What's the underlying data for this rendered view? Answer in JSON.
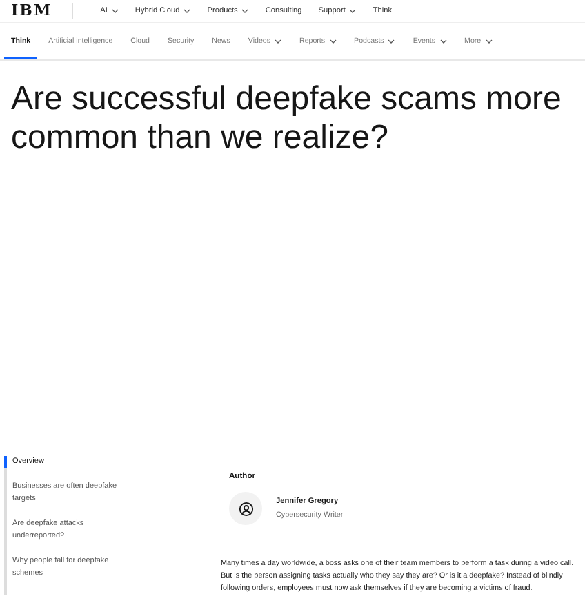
{
  "header": {
    "logo": "IBM",
    "items": [
      {
        "label": "AI",
        "dropdown": true
      },
      {
        "label": "Hybrid Cloud",
        "dropdown": true
      },
      {
        "label": "Products",
        "dropdown": true
      },
      {
        "label": "Consulting",
        "dropdown": false
      },
      {
        "label": "Support",
        "dropdown": true
      },
      {
        "label": "Think",
        "dropdown": false
      }
    ]
  },
  "subnav": [
    {
      "label": "Think",
      "selected": true,
      "dropdown": false
    },
    {
      "label": "Artificial intelligence",
      "selected": false,
      "dropdown": false
    },
    {
      "label": "Cloud",
      "selected": false,
      "dropdown": false
    },
    {
      "label": "Security",
      "selected": false,
      "dropdown": false
    },
    {
      "label": "News",
      "selected": false,
      "dropdown": false
    },
    {
      "label": "Videos",
      "selected": false,
      "dropdown": true
    },
    {
      "label": "Reports",
      "selected": false,
      "dropdown": true
    },
    {
      "label": "Podcasts",
      "selected": false,
      "dropdown": true
    },
    {
      "label": "Events",
      "selected": false,
      "dropdown": true
    },
    {
      "label": "More",
      "selected": false,
      "dropdown": true
    }
  ],
  "title": "Are successful deepfake scams more common than we realize?",
  "toc": [
    {
      "label": "Overview",
      "selected": true
    },
    {
      "label": "Businesses are often deepfake targets",
      "selected": false
    },
    {
      "label": "Are deepfake attacks underreported?",
      "selected": false
    },
    {
      "label": "Why people fall for deepfake schemes",
      "selected": false
    }
  ],
  "author": {
    "heading": "Author",
    "name": "Jennifer Gregory",
    "role": "Cybersecurity Writer"
  },
  "intro": "Many times a day worldwide, a boss asks one of their team members to perform a task during a video call. But is the person assigning tasks actually who they say they are? Or is it a deepfake? Instead of blindly following orders, employees must now ask themselves if they are becoming a victims of fraud."
}
